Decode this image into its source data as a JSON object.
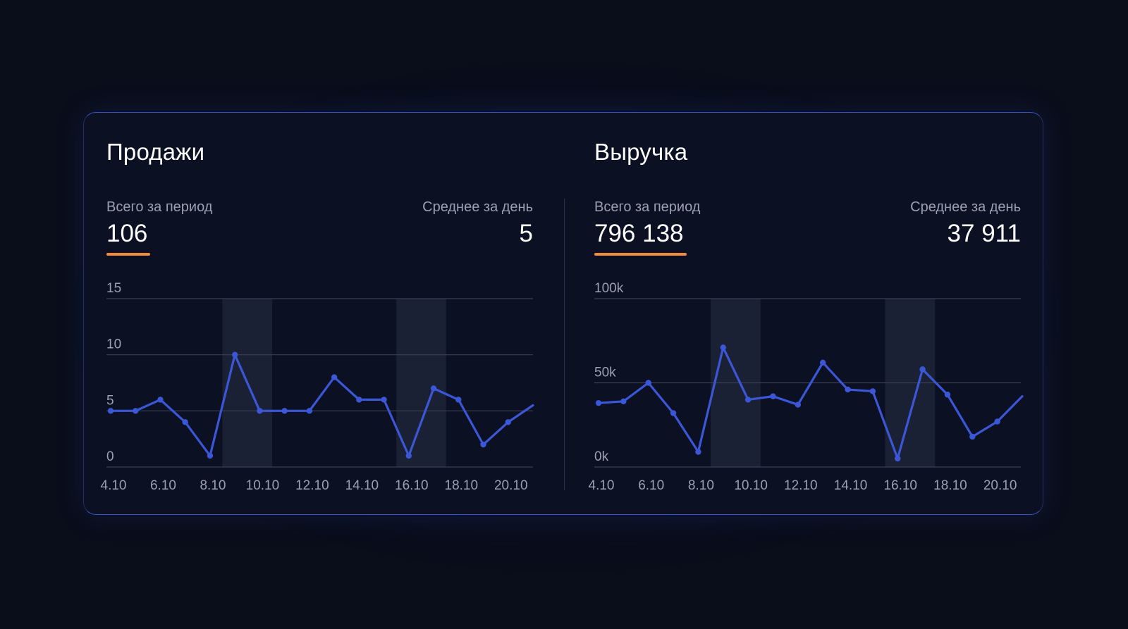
{
  "panels": [
    {
      "title": "Продажи",
      "total_label": "Всего за период",
      "total_value": "106",
      "avg_label": "Среднее за день",
      "avg_value": "5"
    },
    {
      "title": "Выручка",
      "total_label": "Всего за период",
      "total_value": "796 138",
      "avg_label": "Среднее за день",
      "avg_value": "37 911"
    }
  ],
  "colors": {
    "background": "#0a0d1a",
    "card": "#0c1023",
    "line": "#3b56d6",
    "accent_underline": "#f08a3c",
    "highlight_band": "#1f2437",
    "grid": "#3a3f55",
    "label": "#9aa0b4"
  },
  "chart_data": [
    {
      "type": "line",
      "x": [
        "4.10",
        "5.10",
        "6.10",
        "7.10",
        "8.10",
        "9.10",
        "10.10",
        "11.10",
        "12.10",
        "13.10",
        "14.10",
        "15.10",
        "16.10",
        "17.10",
        "18.10",
        "19.10",
        "20.10",
        "21.10"
      ],
      "x_tick_labels": [
        "4.10",
        "6.10",
        "8.10",
        "10.10",
        "12.10",
        "14.10",
        "16.10",
        "18.10",
        "20.10"
      ],
      "series": [
        {
          "values": [
            5,
            5,
            6,
            4,
            1,
            10,
            5,
            5,
            5,
            8,
            6,
            6,
            1,
            7,
            6,
            2,
            4,
            5.5
          ]
        }
      ],
      "y_ticks": [
        0,
        5,
        10,
        15
      ],
      "y_tick_labels": [
        "0",
        "5",
        "10",
        "15"
      ],
      "ylim": [
        0,
        15
      ],
      "highlighted_ranges": [
        [
          "9.10",
          "10.10"
        ],
        [
          "16.10",
          "17.10"
        ]
      ],
      "grid": true
    },
    {
      "type": "line",
      "x": [
        "4.10",
        "5.10",
        "6.10",
        "7.10",
        "8.10",
        "9.10",
        "10.10",
        "11.10",
        "12.10",
        "13.10",
        "14.10",
        "15.10",
        "16.10",
        "17.10",
        "18.10",
        "19.10",
        "20.10",
        "21.10"
      ],
      "x_tick_labels": [
        "4.10",
        "6.10",
        "8.10",
        "10.10",
        "12.10",
        "14.10",
        "16.10",
        "18.10",
        "20.10"
      ],
      "series": [
        {
          "values": [
            38000,
            39000,
            50000,
            32000,
            9000,
            71000,
            40000,
            42000,
            37000,
            62000,
            46000,
            45000,
            5000,
            58000,
            43000,
            18000,
            27000,
            42000
          ]
        }
      ],
      "y_ticks": [
        0,
        50000,
        100000
      ],
      "y_tick_labels": [
        "0k",
        "50k",
        "100k"
      ],
      "ylim": [
        0,
        100000
      ],
      "highlighted_ranges": [
        [
          "9.10",
          "10.10"
        ],
        [
          "16.10",
          "17.10"
        ]
      ],
      "grid": true
    }
  ]
}
